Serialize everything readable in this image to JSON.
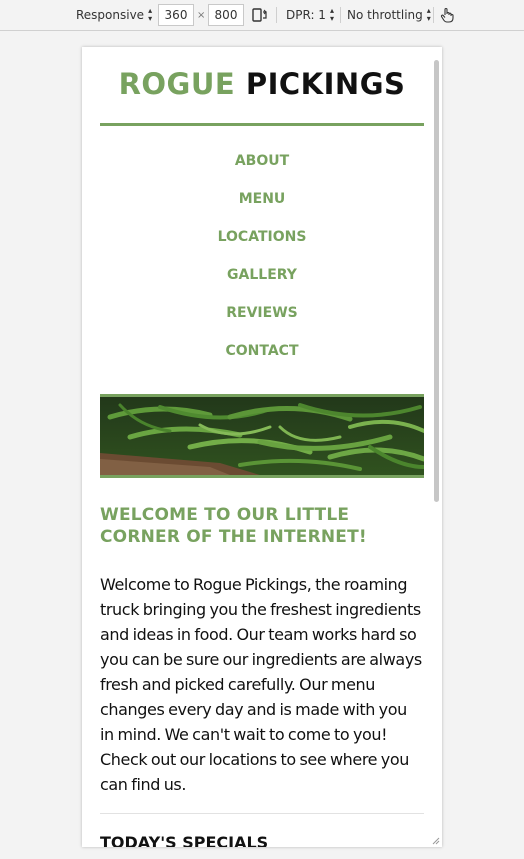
{
  "devtools": {
    "device_mode": "Responsive",
    "width": "360",
    "separator": "×",
    "height": "800",
    "dpr": "DPR: 1",
    "throttling": "No throttling"
  },
  "site": {
    "logo_part1": "ROGUE",
    "logo_part2": "PICKINGS",
    "nav": [
      "ABOUT",
      "MENU",
      "LOCATIONS",
      "GALLERY",
      "REVIEWS",
      "CONTACT"
    ],
    "welcome_heading": "WELCOME TO OUR LITTLE CORNER OF THE INTERNET!",
    "intro": "Welcome to Rogue Pickings, the roaming truck bringing you the freshest ingredients and ideas in food. Our team works hard so you can be sure our ingredients are always fresh and picked carefully. Our menu changes every day and is made with you in mind. We can't wait to come to you! Check out our locations to see where you can find us.",
    "specials_heading": "TODAY'S SPECIALS"
  },
  "colors": {
    "accent": "#78a25f",
    "text": "#111111",
    "page_bg": "#f3f3f3"
  }
}
